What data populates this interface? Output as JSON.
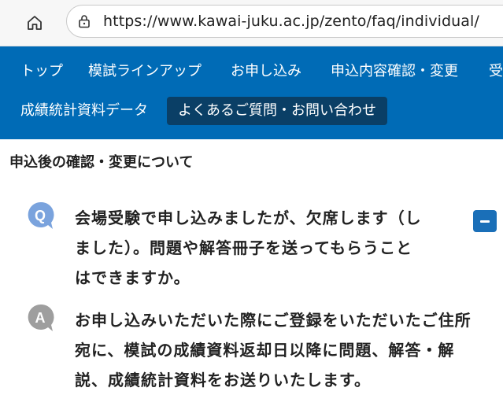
{
  "browser": {
    "url": "https://www.kawai-juku.ac.jp/zento/faq/individual/"
  },
  "nav": {
    "row1": [
      "トップ",
      "模試ラインアップ",
      "お申し込み",
      "申込内容確認・変更",
      "受"
    ],
    "row2": [
      "成績統計資料データ"
    ],
    "active_label": "よくあるご質問・お問い合わせ"
  },
  "section": {
    "title": "申込後の確認・変更について"
  },
  "faq": {
    "question": {
      "badge": "Q",
      "lines": [
        "会場受験で申し込みましたが、欠席します（し",
        "ました）。問題や解答冊子を送ってもらうこと",
        "はできますか。"
      ]
    },
    "answer": {
      "badge": "A",
      "lines": [
        "お申し込みいただいた際にご登録をいただいたご住所",
        "宛に、模試の成績資料返却日以降に問題、解答・解",
        "説、成績統計資料をお送りいたします。"
      ]
    },
    "toggle_symbol": "−"
  },
  "colors": {
    "nav_bg": "#006bb6",
    "active_bg": "#0a3f66",
    "q_badge": "#7aa3dd",
    "a_badge": "#9e9e9e",
    "toggle": "#1a6fb8"
  }
}
